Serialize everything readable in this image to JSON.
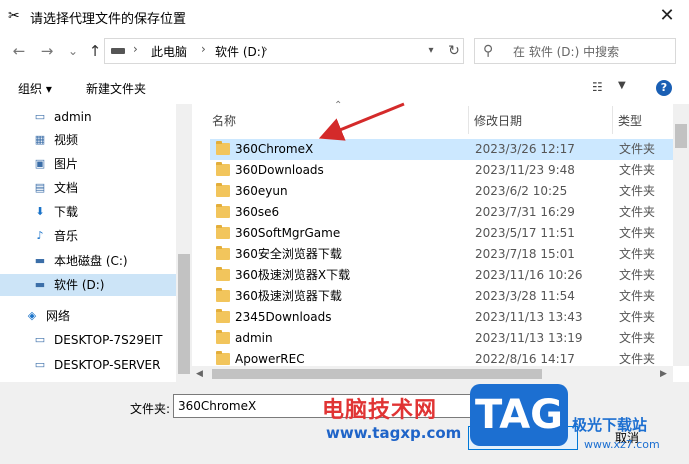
{
  "window": {
    "title": "请选择代理文件的保存位置",
    "app_icon": "capcut-logo-icon",
    "close_glyph": "✕"
  },
  "nav": {
    "back_glyph": "←",
    "forward_glyph": "→",
    "recent_glyph": "⌄",
    "up_glyph": "↑",
    "breadcrumb": [
      "此电脑",
      "软件 (D:)"
    ],
    "search_placeholder": "在 软件 (D:) 中搜索"
  },
  "toolbar": {
    "organize_label": "组织 ▾",
    "new_folder_label": "新建文件夹",
    "view_glyph": "☷",
    "help_glyph": "?"
  },
  "sidebar": {
    "items": [
      {
        "label": "admin",
        "icon": "user-folder-icon",
        "glyph": "▭"
      },
      {
        "label": "视频",
        "icon": "video-icon",
        "glyph": "▦"
      },
      {
        "label": "图片",
        "icon": "picture-icon",
        "glyph": "▣"
      },
      {
        "label": "文档",
        "icon": "document-icon",
        "glyph": "▤"
      },
      {
        "label": "下载",
        "icon": "download-icon",
        "glyph": "⬇"
      },
      {
        "label": "音乐",
        "icon": "music-icon",
        "glyph": "♪"
      },
      {
        "label": "本地磁盘 (C:)",
        "icon": "drive-icon",
        "glyph": "▬"
      },
      {
        "label": "软件 (D:)",
        "icon": "drive-icon",
        "glyph": "▬",
        "selected": true
      },
      {
        "label": "网络",
        "icon": "network-icon",
        "glyph": "◈"
      },
      {
        "label": "DESKTOP-7S29EIT",
        "icon": "computer-icon",
        "glyph": "▭"
      },
      {
        "label": "DESKTOP-SERVER",
        "icon": "computer-icon",
        "glyph": "▭"
      }
    ]
  },
  "columns": {
    "name": "名称",
    "date": "修改日期",
    "type": "类型"
  },
  "files": [
    {
      "name": "360ChromeX",
      "date": "2023/3/26 12:17",
      "type": "文件夹",
      "selected": true
    },
    {
      "name": "360Downloads",
      "date": "2023/11/23 9:48",
      "type": "文件夹"
    },
    {
      "name": "360eyun",
      "date": "2023/6/2 10:25",
      "type": "文件夹"
    },
    {
      "name": "360se6",
      "date": "2023/7/31 16:29",
      "type": "文件夹"
    },
    {
      "name": "360SoftMgrGame",
      "date": "2023/5/17 11:51",
      "type": "文件夹"
    },
    {
      "name": "360安全浏览器下载",
      "date": "2023/7/18 15:01",
      "type": "文件夹"
    },
    {
      "name": "360极速浏览器X下载",
      "date": "2023/11/16 10:26",
      "type": "文件夹"
    },
    {
      "name": "360极速浏览器下载",
      "date": "2023/3/28 11:54",
      "type": "文件夹"
    },
    {
      "name": "2345Downloads",
      "date": "2023/11/13 13:43",
      "type": "文件夹"
    },
    {
      "name": "admin",
      "date": "2023/11/13 13:19",
      "type": "文件夹"
    },
    {
      "name": "ApowerREC",
      "date": "2022/8/16 14:17",
      "type": "文件夹"
    }
  ],
  "bottom": {
    "folder_label": "文件夹:",
    "folder_value": "360ChromeX",
    "select_label": "选择文件夹",
    "cancel_label": "取消"
  },
  "watermark": {
    "main": "电脑技术网",
    "url": "www.tagxp.com",
    "tag": "TAG",
    "brand": "极光下载站",
    "brand_url": "www.xz7.com"
  },
  "colors": {
    "selection": "#cce8ff",
    "accent": "#0078d7",
    "folder": "#f2c55c",
    "annotation_arrow": "#d42a2a"
  }
}
